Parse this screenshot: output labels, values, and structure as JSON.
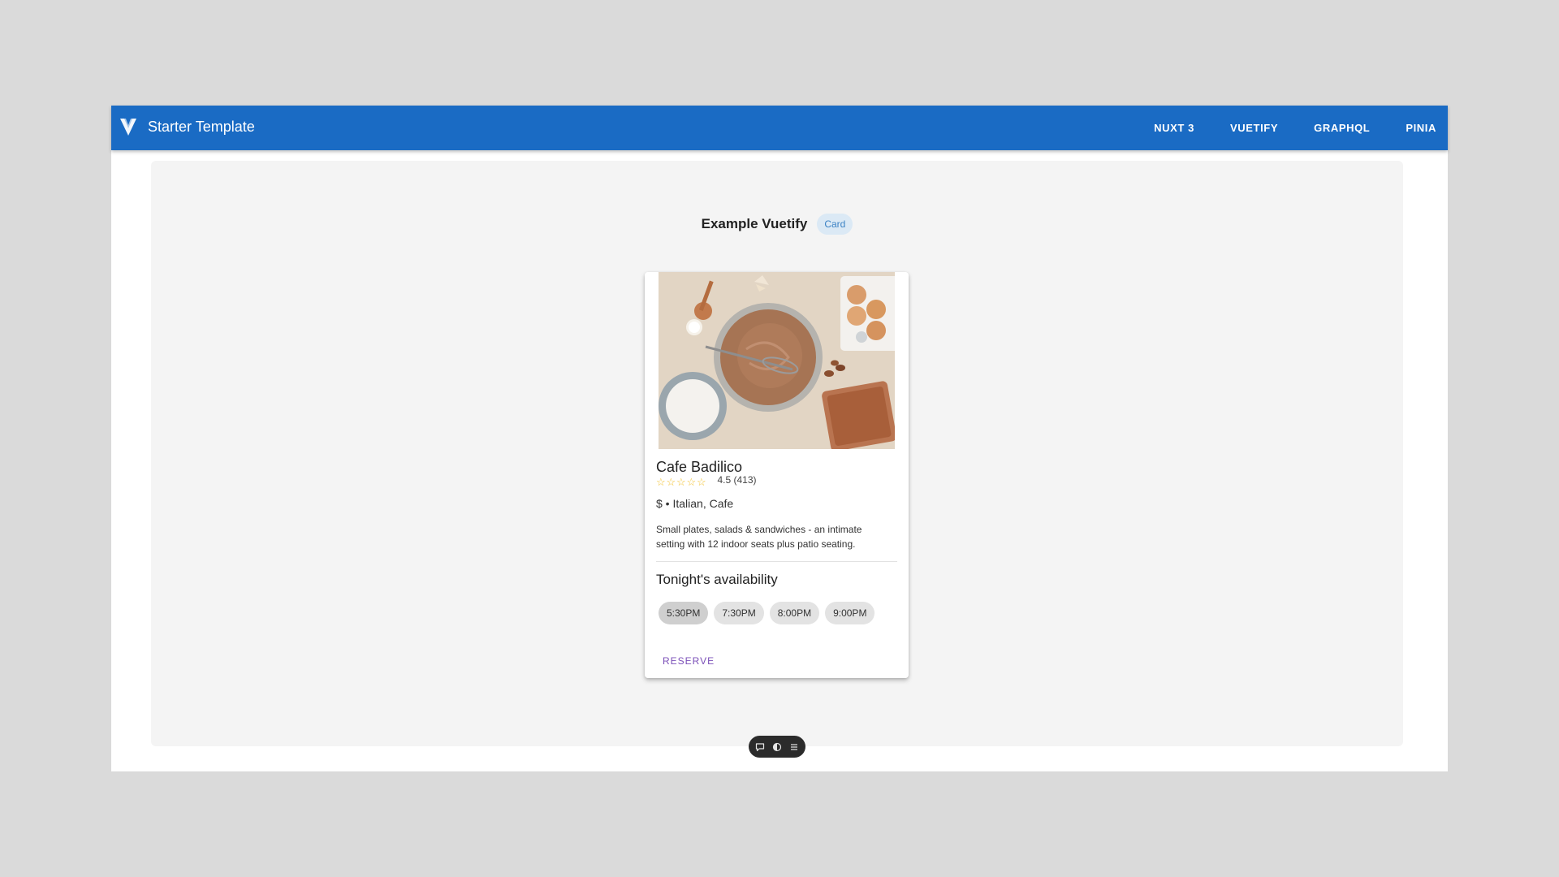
{
  "appbar": {
    "title": "Starter Template",
    "color": "#1a6bc4",
    "logo_icon": "vuetify-logo-icon",
    "nav": [
      {
        "label": "NUXT 3"
      },
      {
        "label": "VUETIFY"
      },
      {
        "label": "GRAPHQL"
      },
      {
        "label": "PINIA"
      }
    ]
  },
  "page": {
    "heading": "Example Vuetify",
    "chip": "Card"
  },
  "card": {
    "image_icon": "baking-photo-image",
    "title": "Cafe Badilico",
    "rating_value": 4.5,
    "rating_max": 5,
    "rating_text": "4.5 (413)",
    "subtitle": "$ • Italian, Cafe",
    "description": "Small plates, salads & sandwiches - an intimate setting with 12 indoor seats plus patio seating.",
    "availability_title": "Tonight's availability",
    "times": [
      "5:30PM",
      "7:30PM",
      "8:00PM",
      "9:00PM"
    ],
    "selected_time": "5:30PM",
    "reserve_label": "RESERVE",
    "accent_color": "#7b4fb8"
  },
  "floating_toolbar": {
    "icons": [
      "chat-icon",
      "toggle-icon",
      "menu-icon"
    ]
  }
}
